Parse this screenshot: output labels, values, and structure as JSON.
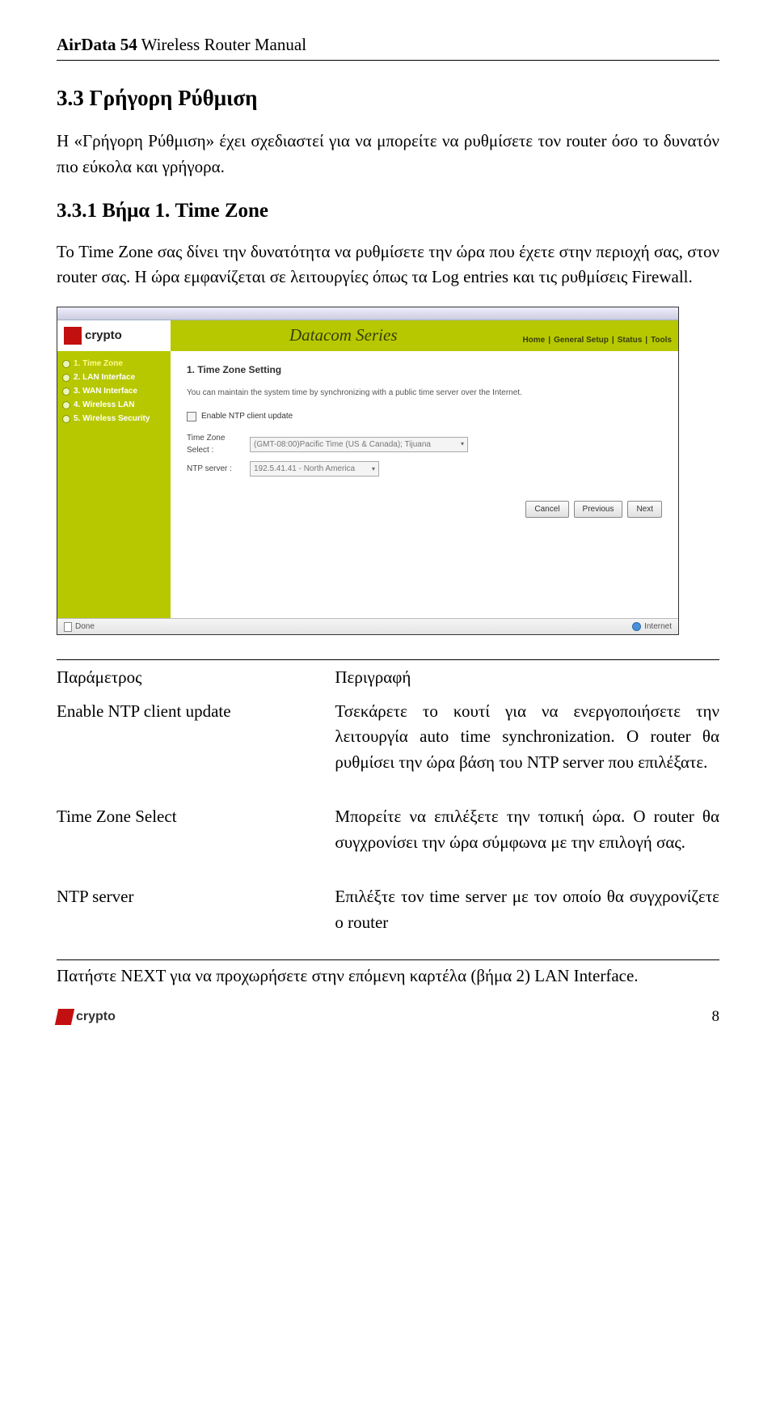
{
  "header": {
    "title": "AirData 54",
    "rest": " Wireless Router Manual"
  },
  "section": {
    "num_title": "3.3  Γρήγορη Ρύθμιση"
  },
  "intro": "Η «Γρήγορη Ρύθμιση» έχει σχεδιαστεί για να μπορείτε να ρυθμίσετε τον router όσο το δυνατόν πιο εύκολα και γρήγορα.",
  "subsection": "3.3.1  Βήμα 1. Time Zone",
  "sub_para": "Το Time Zone σας δίνει την δυνατότητα να ρυθμίσετε την ώρα που έχετε στην περιοχή σας, στον router σας. Η ώρα εμφανίζεται σε λειτουργίες όπως τα Log entries και τις ρυθμίσεις Firewall.",
  "screenshot": {
    "brand": "crypto",
    "banner_title": "Datacom Series",
    "top_links": [
      "Home",
      "General Setup",
      "Status",
      "Tools"
    ],
    "sidebar": [
      {
        "label": "1. Time Zone",
        "active": true
      },
      {
        "label": "2. LAN Interface",
        "active": false
      },
      {
        "label": "3. WAN Interface",
        "active": false
      },
      {
        "label": "4. Wireless LAN",
        "active": false
      },
      {
        "label": "5. Wireless Security",
        "active": false
      }
    ],
    "panel_title": "1. Time Zone Setting",
    "panel_desc": "You can maintain the system time by synchronizing with a public time server over the Internet.",
    "chk_label": "Enable NTP client update",
    "tz_label": "Time Zone Select :",
    "tz_value": "(GMT-08:00)Pacific Time (US & Canada); Tijuana",
    "ntp_label": "NTP server :",
    "ntp_value": "192.5.41.41 - North America",
    "buttons": [
      "Cancel",
      "Previous",
      "Next"
    ],
    "status_done": "Done",
    "status_net": "Internet"
  },
  "params": {
    "head_left": "Παράμετρος",
    "head_right": "Περιγραφή",
    "rows": [
      {
        "left": "Enable NTP client update",
        "right": "Τσεκάρετε το κουτί για να ενεργοποιήσετε την λειτουργία auto time synchronization. Ο router θα ρυθμίσει την ώρα βάση του NTP server που επιλέξατε."
      },
      {
        "left": "Time Zone Select",
        "right": "Μπορείτε να επιλέξετε την τοπική ώρα. Ο router θα συγχρονίσει την  ώρα σύμφωνα με την επιλογή σας."
      },
      {
        "left": "NTP server",
        "right": "Επιλέξτε τον time server με τον οποίο θα συγχρονίζετε ο router"
      }
    ]
  },
  "next_text": "Πατήστε NEXT για να προχωρήσετε στην επόμενη καρτέλα (βήμα 2) LAN Interface.",
  "footer": {
    "brand": "crypto",
    "page": "8"
  }
}
